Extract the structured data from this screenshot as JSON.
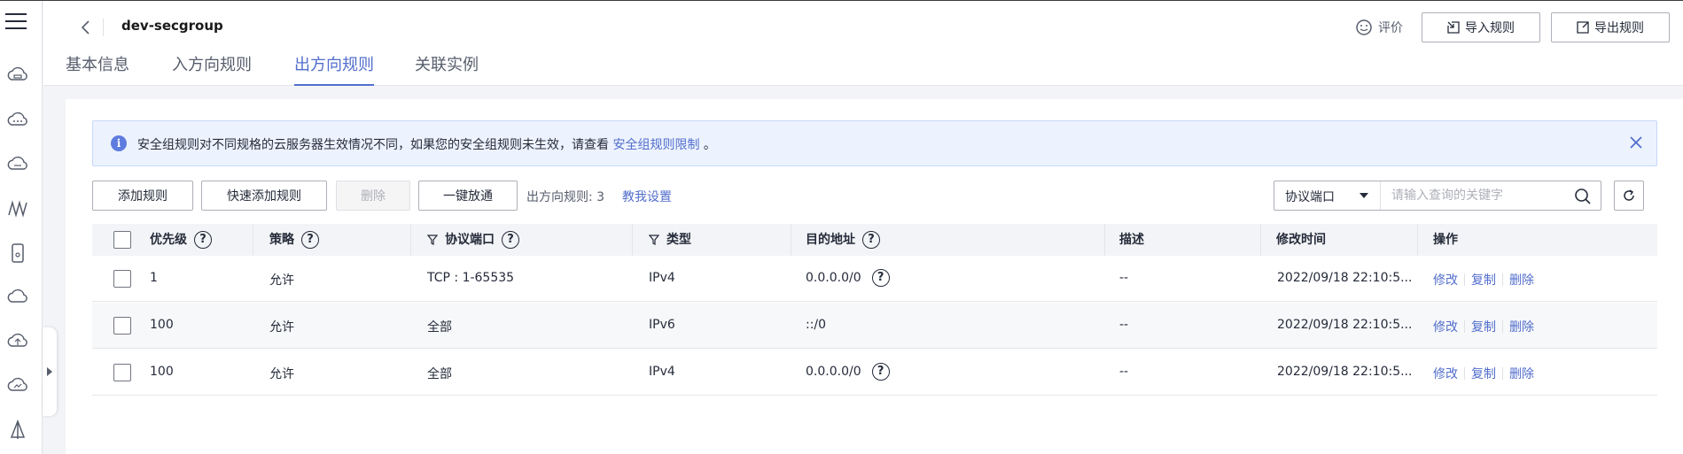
{
  "header": {
    "title": "dev-secgroup",
    "rate_label": "评价",
    "import_label": "导入规则",
    "export_label": "导出规则"
  },
  "tabs": [
    {
      "label": "基本信息",
      "active": false
    },
    {
      "label": "入方向规则",
      "active": false
    },
    {
      "label": "出方向规则",
      "active": true
    },
    {
      "label": "关联实例",
      "active": false
    }
  ],
  "alert": {
    "text": "安全组规则对不同规格的云服务器生效情况不同，如果您的安全组规则未生效，请查看 ",
    "link": "安全组规则限制",
    "suffix": " 。"
  },
  "toolbar": {
    "add_label": "添加规则",
    "quick_add_label": "快速添加规则",
    "delete_label": "删除",
    "allow_all_label": "一键放通",
    "count_text": "出方向规则: 3",
    "teach_label": "教我设置"
  },
  "search": {
    "select_value": "协议端口",
    "placeholder": "请输入查询的关键字"
  },
  "table": {
    "headers": {
      "priority": "优先级",
      "policy": "策略",
      "protocol": "协议端口",
      "type": "类型",
      "destination": "目的地址",
      "description": "描述",
      "modified": "修改时间",
      "actions": "操作"
    },
    "rows": [
      {
        "priority": "1",
        "policy": "允许",
        "protocol": "TCP : 1-65535",
        "type": "IPv4",
        "destination": "0.0.0.0/0",
        "has_help": true,
        "description": "--",
        "modified": "2022/09/18 22:10:5...",
        "edit": "修改",
        "copy": "复制",
        "delete": "删除"
      },
      {
        "priority": "100",
        "policy": "允许",
        "protocol": "全部",
        "type": "IPv6",
        "destination": "::/0",
        "has_help": false,
        "description": "--",
        "modified": "2022/09/18 22:10:5...",
        "edit": "修改",
        "copy": "复制",
        "delete": "删除"
      },
      {
        "priority": "100",
        "policy": "允许",
        "protocol": "全部",
        "type": "IPv4",
        "destination": "0.0.0.0/0",
        "has_help": true,
        "description": "--",
        "modified": "2022/09/18 22:10:5...",
        "edit": "修改",
        "copy": "复制",
        "delete": "删除"
      }
    ]
  },
  "icons": [
    "menu-icon",
    "cloud-server-icon",
    "more-cloud-icon",
    "cloud-disk-icon",
    "network-icon",
    "storage-icon",
    "cloud-icon",
    "upload-cloud-icon",
    "cloud-link-icon",
    "tower-icon"
  ],
  "colors": {
    "accent": "#526ecc",
    "alert_bg": "#edf3fe"
  }
}
